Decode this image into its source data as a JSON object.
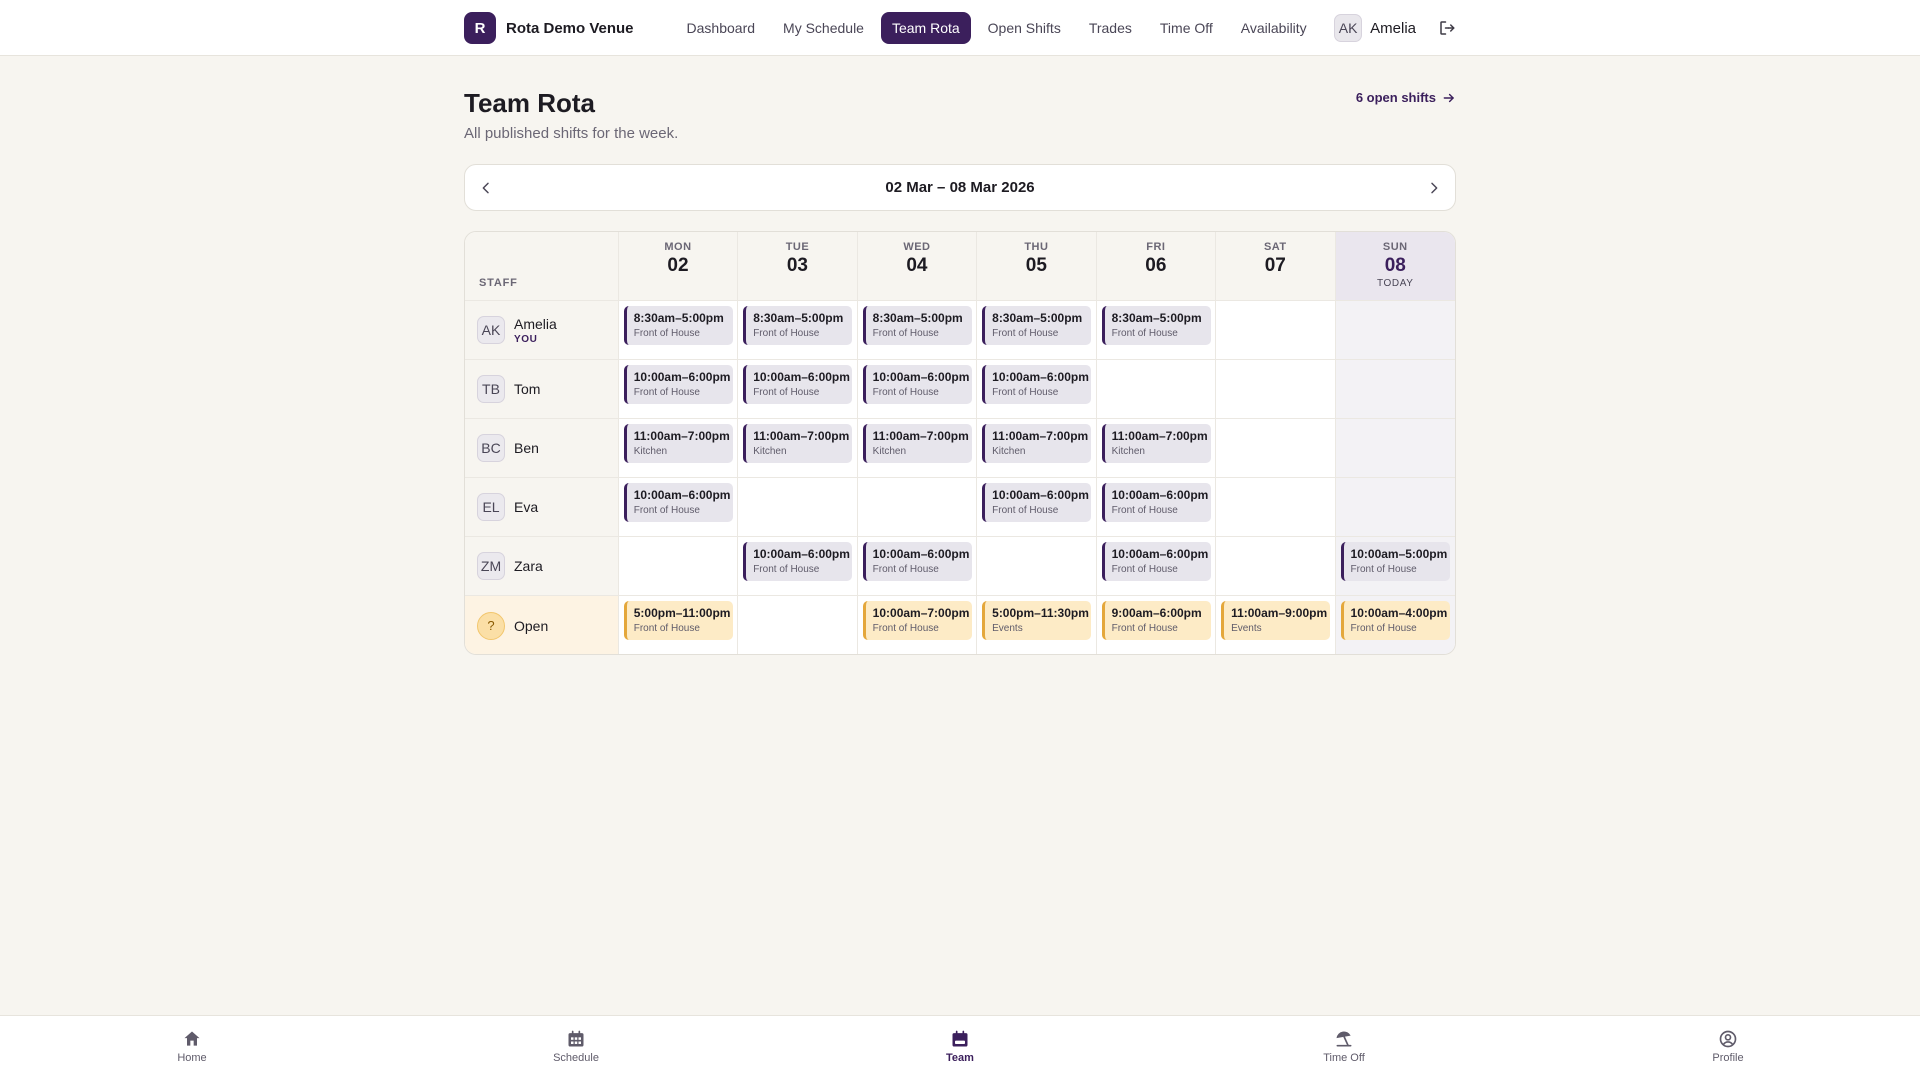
{
  "brand": {
    "logo_letter": "R",
    "name": "Rota Demo Venue"
  },
  "nav": {
    "items": [
      {
        "label": "Dashboard",
        "active": false
      },
      {
        "label": "My Schedule",
        "active": false
      },
      {
        "label": "Team Rota",
        "active": true
      },
      {
        "label": "Open Shifts",
        "active": false
      },
      {
        "label": "Trades",
        "active": false
      },
      {
        "label": "Time Off",
        "active": false
      },
      {
        "label": "Availability",
        "active": false
      }
    ]
  },
  "user": {
    "initials": "AK",
    "name": "Amelia"
  },
  "page": {
    "title": "Team Rota",
    "subtitle": "All published shifts for the week.",
    "open_shifts_link": "6 open shifts"
  },
  "week": {
    "label": "02 Mar – 08 Mar 2026"
  },
  "grid": {
    "staff_header": "STAFF",
    "days": [
      {
        "dow": "MON",
        "dom": "02",
        "today": false,
        "today_label": ""
      },
      {
        "dow": "TUE",
        "dom": "03",
        "today": false,
        "today_label": ""
      },
      {
        "dow": "WED",
        "dom": "04",
        "today": false,
        "today_label": ""
      },
      {
        "dow": "THU",
        "dom": "05",
        "today": false,
        "today_label": ""
      },
      {
        "dow": "FRI",
        "dom": "06",
        "today": false,
        "today_label": ""
      },
      {
        "dow": "SAT",
        "dom": "07",
        "today": false,
        "today_label": ""
      },
      {
        "dow": "SUN",
        "dom": "08",
        "today": true,
        "today_label": "TODAY"
      }
    ],
    "rows": [
      {
        "initials": "AK",
        "name": "Amelia",
        "tag": "YOU",
        "open": false,
        "shifts": [
          {
            "time": "8:30am–5:00pm",
            "role": "Front of House"
          },
          {
            "time": "8:30am–5:00pm",
            "role": "Front of House"
          },
          {
            "time": "8:30am–5:00pm",
            "role": "Front of House"
          },
          {
            "time": "8:30am–5:00pm",
            "role": "Front of House"
          },
          {
            "time": "8:30am–5:00pm",
            "role": "Front of House"
          },
          null,
          null
        ]
      },
      {
        "initials": "TB",
        "name": "Tom",
        "tag": "",
        "open": false,
        "shifts": [
          {
            "time": "10:00am–6:00pm",
            "role": "Front of House"
          },
          {
            "time": "10:00am–6:00pm",
            "role": "Front of House"
          },
          {
            "time": "10:00am–6:00pm",
            "role": "Front of House"
          },
          {
            "time": "10:00am–6:00pm",
            "role": "Front of House"
          },
          null,
          null,
          null
        ]
      },
      {
        "initials": "BC",
        "name": "Ben",
        "tag": "",
        "open": false,
        "shifts": [
          {
            "time": "11:00am–7:00pm",
            "role": "Kitchen"
          },
          {
            "time": "11:00am–7:00pm",
            "role": "Kitchen"
          },
          {
            "time": "11:00am–7:00pm",
            "role": "Kitchen"
          },
          {
            "time": "11:00am–7:00pm",
            "role": "Kitchen"
          },
          {
            "time": "11:00am–7:00pm",
            "role": "Kitchen"
          },
          null,
          null
        ]
      },
      {
        "initials": "EL",
        "name": "Eva",
        "tag": "",
        "open": false,
        "shifts": [
          {
            "time": "10:00am–6:00pm",
            "role": "Front of House"
          },
          null,
          null,
          {
            "time": "10:00am–6:00pm",
            "role": "Front of House"
          },
          {
            "time": "10:00am–6:00pm",
            "role": "Front of House"
          },
          null,
          null
        ]
      },
      {
        "initials": "ZM",
        "name": "Zara",
        "tag": "",
        "open": false,
        "shifts": [
          null,
          {
            "time": "10:00am–6:00pm",
            "role": "Front of House"
          },
          {
            "time": "10:00am–6:00pm",
            "role": "Front of House"
          },
          null,
          {
            "time": "10:00am–6:00pm",
            "role": "Front of House"
          },
          null,
          {
            "time": "10:00am–5:00pm",
            "role": "Front of House"
          }
        ]
      },
      {
        "initials": "?",
        "name": "Open",
        "tag": "",
        "open": true,
        "shifts": [
          {
            "time": "5:00pm–11:00pm",
            "role": "Front of House"
          },
          null,
          {
            "time": "10:00am–7:00pm",
            "role": "Front of House"
          },
          {
            "time": "5:00pm–11:30pm",
            "role": "Events"
          },
          {
            "time": "9:00am–6:00pm",
            "role": "Front of House"
          },
          {
            "time": "11:00am–9:00pm",
            "role": "Events"
          },
          {
            "time": "10:00am–4:00pm",
            "role": "Front of House"
          }
        ]
      }
    ]
  },
  "bottom_tabs": [
    {
      "label": "Home",
      "icon": "home-icon",
      "active": false
    },
    {
      "label": "Schedule",
      "icon": "calendar-grid-icon",
      "active": false
    },
    {
      "label": "Team",
      "icon": "calendar-icon",
      "active": true
    },
    {
      "label": "Time Off",
      "icon": "beach-umbrella-icon",
      "active": false
    },
    {
      "label": "Profile",
      "icon": "user-circle-icon",
      "active": false
    }
  ],
  "colors": {
    "brand": "#3b1f5c",
    "background": "#f7f5f0",
    "open_accent": "#e4a73b",
    "open_fill": "#fdebc6"
  }
}
